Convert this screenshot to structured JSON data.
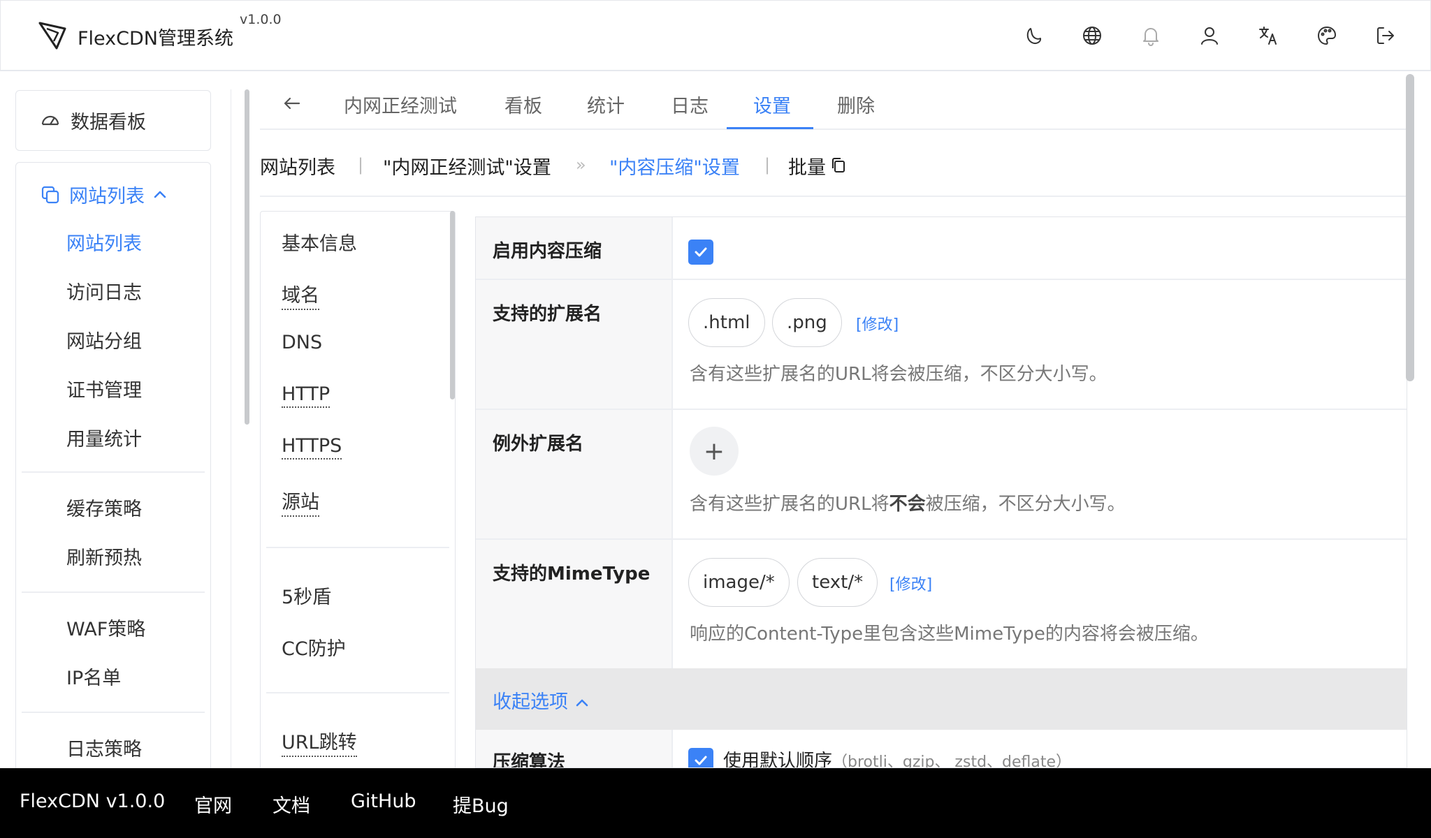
{
  "header": {
    "brand": "FlexCDN管理系统",
    "version": "v1.0.0",
    "icons": [
      "theme-icon",
      "globe-icon",
      "bell-icon",
      "user-icon",
      "translate-icon",
      "palette-icon",
      "logout-icon"
    ]
  },
  "sidebar": {
    "dashboard": "数据看板",
    "group": "网站列表",
    "items": [
      "网站列表",
      "访问日志",
      "网站分组",
      "证书管理",
      "用量统计",
      "缓存策略",
      "刷新预热",
      "WAF策略",
      "IP名单",
      "日志策略"
    ]
  },
  "tabs": {
    "items": [
      "内网正经测试",
      "看板",
      "统计",
      "日志",
      "设置",
      "删除"
    ],
    "active": "设置"
  },
  "breadcrumb": {
    "items": [
      "网站列表",
      "\"内网正经测试\"设置",
      "\"内容压缩\"设置",
      "批量"
    ]
  },
  "menu2": {
    "items": [
      "基本信息",
      "域名",
      "DNS",
      "HTTP",
      "HTTPS",
      "源站",
      "5秒盾",
      "CC防护",
      "URL跳转"
    ]
  },
  "form": {
    "enable_label": "启用内容压缩",
    "enable_checked": true,
    "ext_label": "支持的扩展名",
    "ext_values": [
      ".html",
      ".png"
    ],
    "edit": "[修改]",
    "ext_hint": "含有这些扩展名的URL将会被压缩，不区分大小写。",
    "except_label": "例外扩展名",
    "except_hint_pre": "含有这些扩展名的URL将",
    "except_hint_bold": "不会",
    "except_hint_post": "被压缩，不区分大小写。",
    "mime_label": "支持的MimeType",
    "mime_values": [
      "image/*",
      "text/*"
    ],
    "mime_hint": "响应的Content-Type里包含这些MimeType的内容将会被压缩。",
    "collapse": "收起选项",
    "algo_label": "压缩算法",
    "algo_default": "使用默认顺序",
    "algo_note": "（brotli、gzip、 zstd、deflate）"
  },
  "footer": {
    "items": [
      "FlexCDN v1.0.0",
      "官网",
      "文档",
      "GitHub",
      "提Bug"
    ]
  },
  "colors": {
    "accent": "#3b82f6",
    "footer_bg": "#000000"
  }
}
